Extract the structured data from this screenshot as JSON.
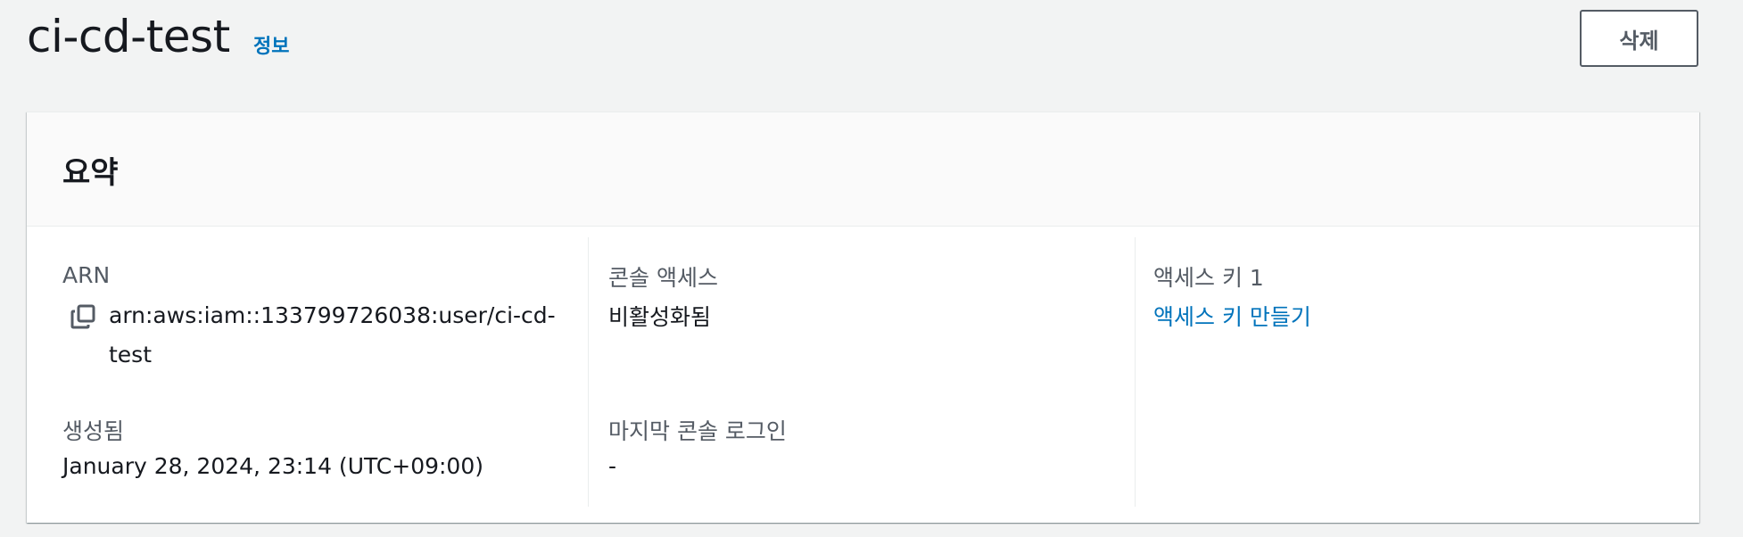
{
  "header": {
    "title": "ci-cd-test",
    "info_link": "정보",
    "delete_label": "삭제"
  },
  "summary": {
    "title": "요약",
    "arn": {
      "label": "ARN",
      "value_line1": "arn:aws:iam::133799726038:user/ci-cd-",
      "value_line2": "test"
    },
    "created": {
      "label": "생성됨",
      "value": "January 28, 2024, 23:14 (UTC+09:00)"
    },
    "console_access": {
      "label": "콘솔 액세스",
      "value": "비활성화됨"
    },
    "last_console_login": {
      "label": "마지막 콘솔 로그인",
      "value": "-"
    },
    "access_key": {
      "label": "액세스 키 1",
      "link": "액세스 키 만들기"
    }
  },
  "colors": {
    "link": "#0073bb",
    "text": "#16191f",
    "label": "#545b64",
    "background": "#f2f3f3"
  },
  "icons": {
    "copy": "copy-icon"
  }
}
